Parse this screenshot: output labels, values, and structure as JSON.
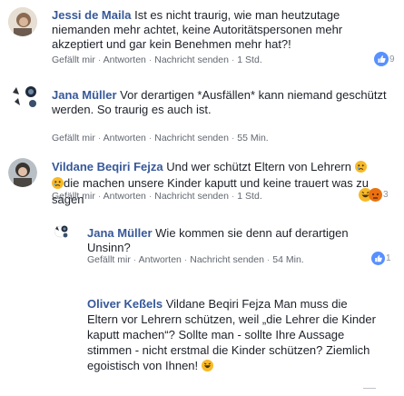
{
  "comments": [
    {
      "name": "Jessi de Maila",
      "text": "Ist es nicht traurig, wie man heutzutage niemanden mehr achtet, keine Autoritätspersonen mehr akzeptiert und gar kein Benehmen mehr hat?!",
      "like": "Gefällt mir",
      "reply": "Antworten",
      "message": "Nachricht senden",
      "time": "1 Std.",
      "reactions": "9"
    },
    {
      "name": "Jana Müller",
      "text": "Vor derartigen *Ausfällen* kann niemand geschützt werden. So traurig es auch ist.",
      "like": "Gefällt mir",
      "reply": "Antworten",
      "message": "Nachricht senden",
      "time": "55 Min."
    },
    {
      "name": "Vildane Beqiri Fejza",
      "text": "Und wer schützt Eltern von Lehrern",
      "text2": "die machen unsere Kinder kaputt und keine trauert was zu sagen",
      "like": "Gefällt mir",
      "reply": "Antworten",
      "message": "Nachricht senden",
      "time": "1 Std.",
      "reactions": "3"
    },
    {
      "name": "Jana Müller",
      "text": "Wie kommen sie denn auf derartigen Unsinn?",
      "like": "Gefällt mir",
      "reply": "Antworten",
      "message": "Nachricht senden",
      "time": "54 Min.",
      "reactions": "1"
    },
    {
      "name": "Oliver Keßels",
      "text": "Vildane Beqiri Fejza Man muss die Eltern vor Lehrern schützen, weil „die Lehrer die Kinder kaputt machen“? Sollte man - sollte Ihre Aussage stimmen - nicht erstmal die Kinder schützen? Ziemlich egoistisch von Ihnen!"
    }
  ],
  "colors": {
    "link": "#365899",
    "like_blue": "#5890ff",
    "meta": "#616770"
  }
}
